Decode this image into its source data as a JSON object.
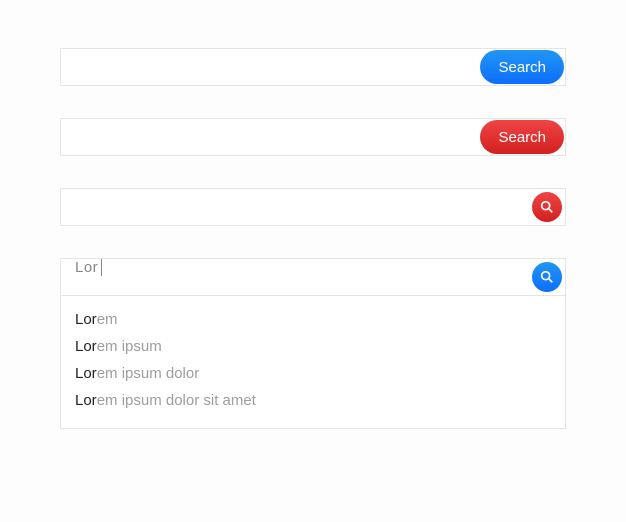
{
  "bars": {
    "blue_pill_label": "Search",
    "red_pill_label": "Search"
  },
  "typed": {
    "value": "Lor"
  },
  "suggestions": [
    {
      "match": "Lor",
      "rest": "em"
    },
    {
      "match": "Lor",
      "rest": "em ipsum"
    },
    {
      "match": "Lor",
      "rest": "em ipsum dolor"
    },
    {
      "match": "Lor",
      "rest": "em ipsum dolor sit amet"
    }
  ]
}
